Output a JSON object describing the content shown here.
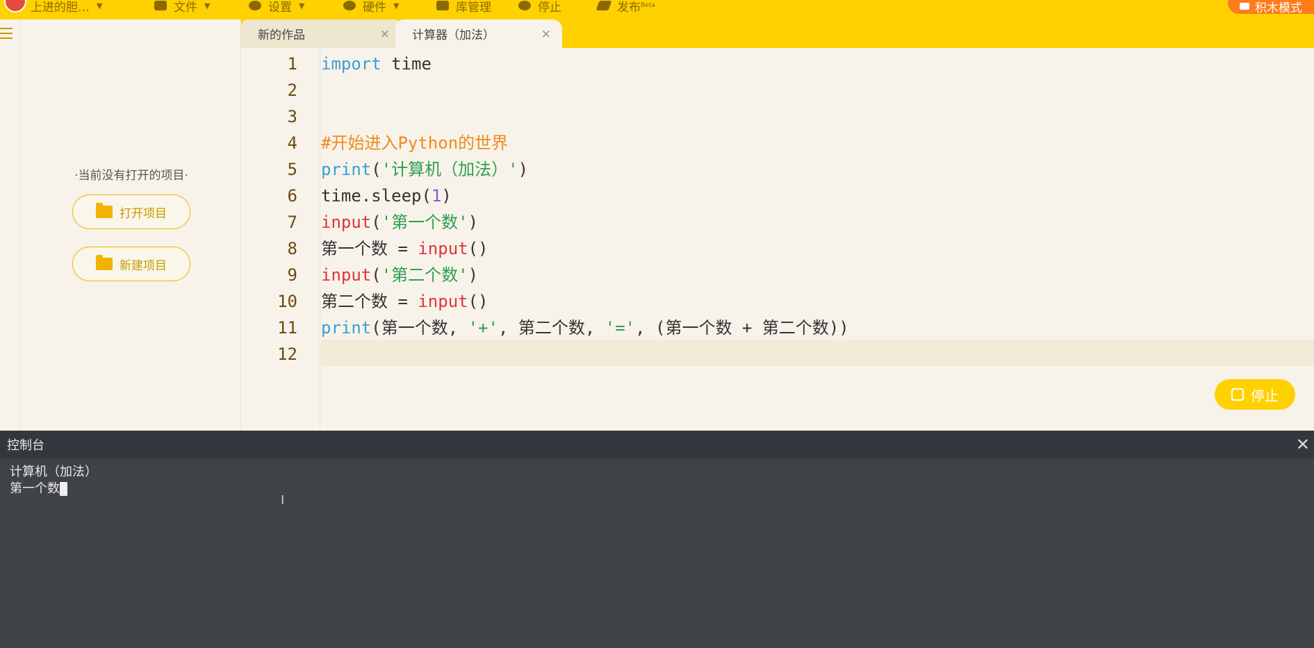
{
  "menubar": {
    "user_name": "上进的胆…",
    "items": [
      {
        "label": "文件",
        "icon": "file-icon"
      },
      {
        "label": "设置",
        "icon": "gear-icon"
      },
      {
        "label": "硬件",
        "icon": "hardware-icon"
      },
      {
        "label": "库管理",
        "icon": "library-icon"
      },
      {
        "label": "停止",
        "icon": "stop-icon"
      },
      {
        "label": "发布",
        "icon": "publish-icon"
      }
    ],
    "beta": "Beta",
    "mode_button": "积木模式"
  },
  "sidebar": {
    "empty_message": "·当前没有打开的项目·",
    "open_project": "打开项目",
    "new_project": "新建项目"
  },
  "tabs": [
    {
      "label": "新的作品",
      "active": false
    },
    {
      "label": "计算器（加法）",
      "active": true
    }
  ],
  "editor": {
    "line_numbers": [
      "1",
      "2",
      "3",
      "4",
      "5",
      "6",
      "7",
      "8",
      "9",
      "10",
      "11",
      "12"
    ],
    "current_line": 12,
    "stop_button": "停止"
  },
  "console": {
    "title": "控制台",
    "output": [
      "计算机（加法）",
      "第一个数"
    ]
  },
  "colors": {
    "accent": "#ffd100",
    "mode_button": "#ff7a1a",
    "keyword_blue": "#3b9ed8",
    "keyword_red": "#e0343a",
    "string": "#2e9d4e",
    "comment": "#f08a1c",
    "console_bg": "#3f4247"
  }
}
